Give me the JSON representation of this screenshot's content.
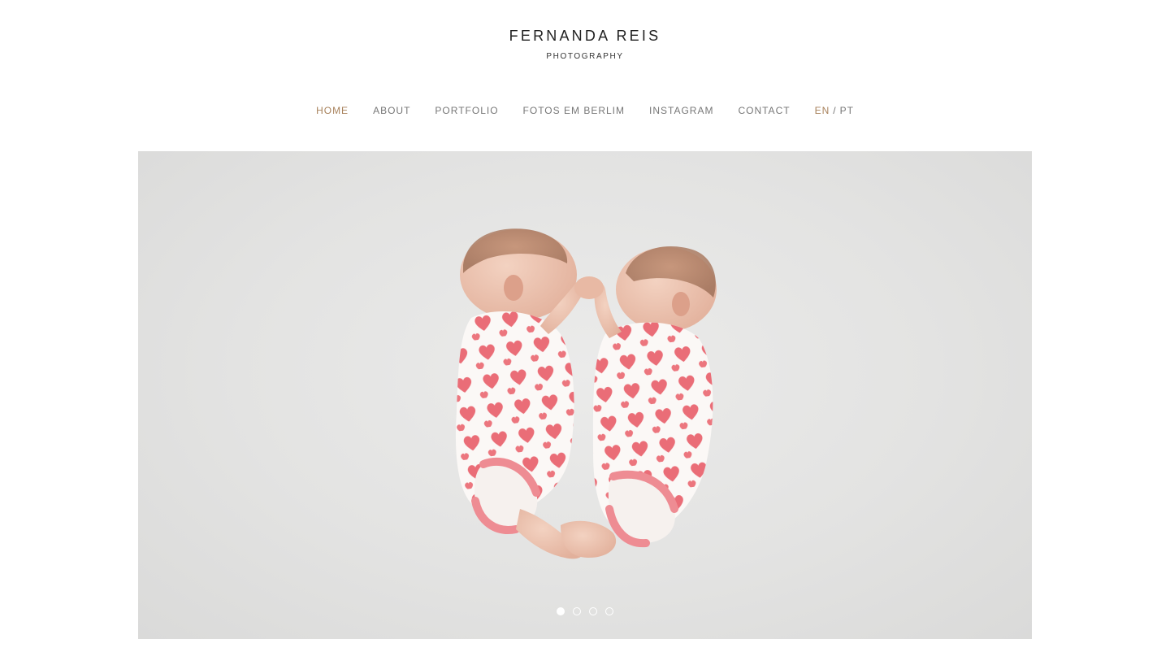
{
  "brand": {
    "name": "FERNANDA REIS",
    "subtitle": "PHOTOGRAPHY"
  },
  "nav": {
    "items": [
      {
        "label": "HOME",
        "active": true
      },
      {
        "label": "ABOUT",
        "active": false
      },
      {
        "label": "PORTFOLIO",
        "active": false
      },
      {
        "label": "FOTOS EM BERLIM",
        "active": false
      },
      {
        "label": "INSTAGRAM",
        "active": false
      },
      {
        "label": "CONTACT",
        "active": false
      }
    ],
    "lang": {
      "en": "EN",
      "separator": "/",
      "pt": "PT",
      "active": "EN"
    }
  },
  "slider": {
    "slide_count": 4,
    "current_slide": 1,
    "image_subject": "twin newborn babies in heart-print bodysuits sleeping"
  },
  "colors": {
    "accent": "#a8825c",
    "nav_text": "#777777",
    "brand_text": "#222222",
    "hero_bg": "#e3e3e2",
    "heart": "#e85560",
    "cuff": "#ee8c93"
  }
}
